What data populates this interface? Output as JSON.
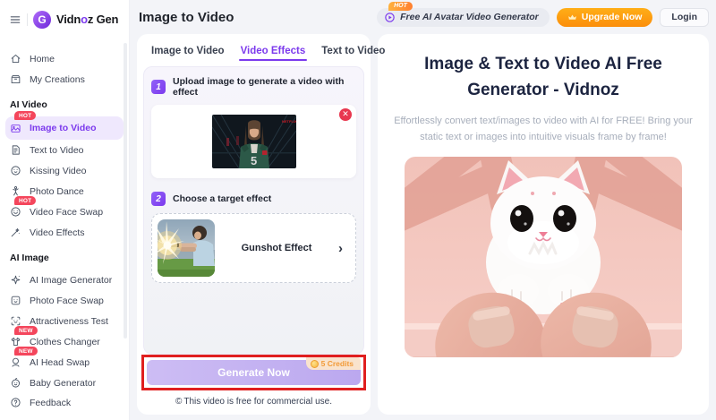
{
  "colors": {
    "accent_purple": "#7C3AED",
    "badge_red": "#F4465C",
    "upgrade_orange": "#FB8E0B",
    "annotation_red": "#E01F1F",
    "generate_lavender": "#BBA8EF",
    "page_bg": "#F3F4F8"
  },
  "sidebar": {
    "brand": {
      "logo_letter": "G",
      "part1": "Vidn",
      "accent": "o",
      "part2": "z Gen"
    },
    "top_items": [
      {
        "label": "Home"
      },
      {
        "label": "My Creations"
      }
    ],
    "sections": [
      {
        "title": "AI Video",
        "items": [
          {
            "label": "Image to Video",
            "badge": "HOT"
          },
          {
            "label": "Text to Video"
          },
          {
            "label": "Kissing Video"
          },
          {
            "label": "Photo Dance"
          },
          {
            "label": "Video Face Swap",
            "badge": "HOT"
          },
          {
            "label": "Video Effects"
          }
        ]
      },
      {
        "title": "AI Image",
        "items": [
          {
            "label": "AI Image Generator"
          },
          {
            "label": "Photo Face Swap"
          },
          {
            "label": "Attractiveness Test"
          },
          {
            "label": "Clothes Changer",
            "badge": "NEW"
          },
          {
            "label": "AI Head Swap",
            "badge": "NEW"
          },
          {
            "label": "Baby Generator"
          }
        ]
      }
    ],
    "feedback": {
      "label": "Feedback"
    }
  },
  "header": {
    "title": "Image to Video",
    "promo_pill": {
      "badge": "HOT",
      "label": "Free AI Avatar Video Generator"
    },
    "upgrade_label": "Upgrade Now",
    "login_label": "Login"
  },
  "generator": {
    "tabs": [
      {
        "label": "Image to Video"
      },
      {
        "label": "Video Effects"
      },
      {
        "label": "Text to Video"
      }
    ],
    "step1": {
      "number": "1",
      "label": "Upload image to generate a video with effect"
    },
    "step2": {
      "number": "2",
      "label": "Choose a target effect"
    },
    "remove_glyph": "✕",
    "effect": {
      "name": "Gunshot Effect",
      "chevron": "›"
    },
    "generate": {
      "label": "Generate Now",
      "credits_badge": "5 Credits"
    },
    "footnote": {
      "icon": "©",
      "text": "This video is free for commercial use."
    }
  },
  "hero": {
    "title": "Image & Text to Video AI Free Generator - Vidnoz",
    "subtitle": "Effortlessly convert text/images to video with AI for FREE! Bring your static text or images into intuitive visuals frame by frame!"
  }
}
